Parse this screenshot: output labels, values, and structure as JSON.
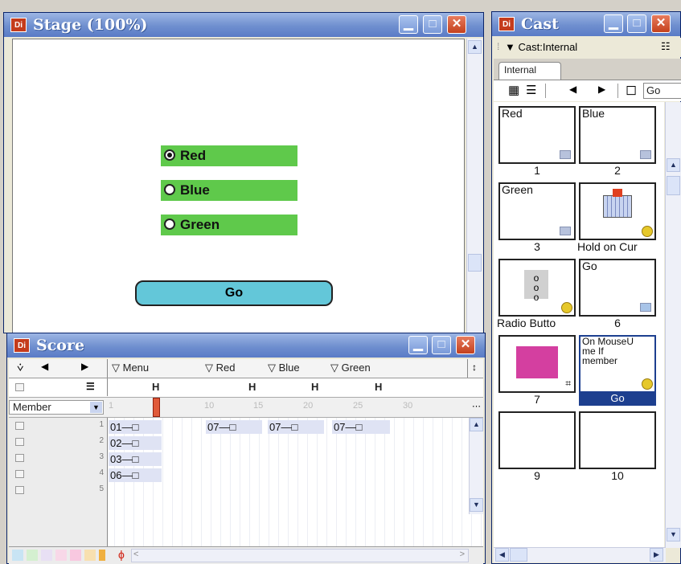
{
  "stage": {
    "title": "Stage (100%)",
    "title_icon": "Di",
    "radio_options": [
      {
        "label": "Red",
        "selected": true
      },
      {
        "label": "Blue",
        "selected": false
      },
      {
        "label": "Green",
        "selected": false
      }
    ],
    "go_button": "Go",
    "button_color": "#63c7d9",
    "radio_bg_color": "#5fc94b"
  },
  "score": {
    "title": "Score",
    "title_icon": "Di",
    "markers": [
      "Menu",
      "Red",
      "Blue",
      "Green"
    ],
    "behavior_marks": [
      "H",
      "H",
      "H",
      "H"
    ],
    "display_mode": "Member",
    "frame_ticks": [
      "1",
      "10",
      "15",
      "20",
      "25",
      "30"
    ],
    "channels": [
      {
        "num": "1",
        "sprites": [
          "01",
          "07",
          "07",
          "07"
        ]
      },
      {
        "num": "2",
        "sprites": [
          "02"
        ]
      },
      {
        "num": "3",
        "sprites": [
          "03"
        ]
      },
      {
        "num": "4",
        "sprites": [
          "06"
        ]
      },
      {
        "num": "5",
        "sprites": []
      }
    ],
    "swatch_colors": [
      "#c8e4f4",
      "#d4f0d0",
      "#e8e0f4",
      "#f8d8e8",
      "#f8e0b0"
    ]
  },
  "cast": {
    "title": "Cast",
    "title_icon": "Di",
    "library_name": "Cast:Internal",
    "tab": "Internal",
    "go_field": "Go",
    "members": [
      {
        "num": "1",
        "name": "Red",
        "under": "1"
      },
      {
        "num": "2",
        "name": "Blue",
        "under": "2"
      },
      {
        "num": "3",
        "name": "Green",
        "under": "3"
      },
      {
        "num": "4",
        "name": "",
        "under": "Hold on Cur"
      },
      {
        "num": "5",
        "name": "",
        "under": "Radio Butto"
      },
      {
        "num": "6",
        "name": "Go",
        "under": "6"
      },
      {
        "num": "7",
        "name": "",
        "under": "7"
      },
      {
        "num": "8",
        "name": "On MouseU me If member",
        "under": "Go"
      },
      {
        "num": "9",
        "name": "",
        "under": "9"
      },
      {
        "num": "10",
        "name": "",
        "under": "10"
      }
    ],
    "selected_color": "#1d3f8f",
    "bitmap_color": "#d43fa0"
  }
}
